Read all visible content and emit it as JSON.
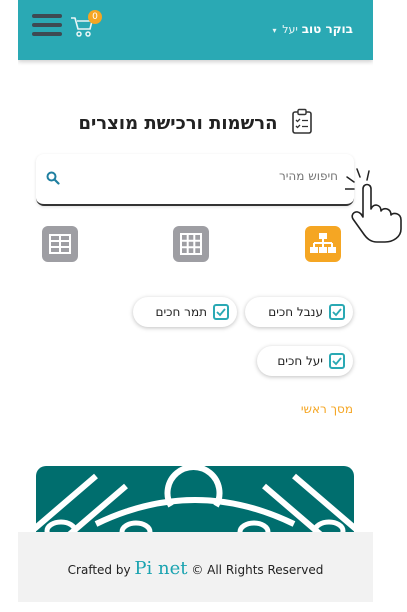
{
  "header": {
    "cart_count": "0",
    "greeting": "בוקר טוב",
    "user_name": "יעל",
    "dropdown_caret": "▾",
    "menu_icon": "hamburger-icon",
    "cart_icon": "cart-icon"
  },
  "page": {
    "title": "הרשמות ורכישת מוצרים",
    "title_icon": "clipboard-check-icon"
  },
  "search": {
    "placeholder": "חיפוש מהיר",
    "icon": "search-icon"
  },
  "view_buttons": [
    {
      "icon": "list-grid-icon",
      "color": "#9e9ea3"
    },
    {
      "icon": "grid-icon",
      "color": "#9e9ea3"
    },
    {
      "icon": "hierarchy-icon",
      "color": "#f5a623"
    }
  ],
  "filters": [
    {
      "label": "ענבל חכים",
      "checked": true
    },
    {
      "label": "תמר חכים",
      "checked": true
    },
    {
      "label": "יעל חכים",
      "checked": true
    }
  ],
  "links": {
    "main_screen": "מסך ראשי"
  },
  "footer": {
    "prefix": "Crafted by",
    "brand": "Pi net",
    "suffix": "© All Rights Reserved"
  },
  "colors": {
    "primary": "#2aa9b4",
    "accent": "#f5a623",
    "neutral": "#9e9ea3",
    "logo_bg": "#006e6e"
  }
}
